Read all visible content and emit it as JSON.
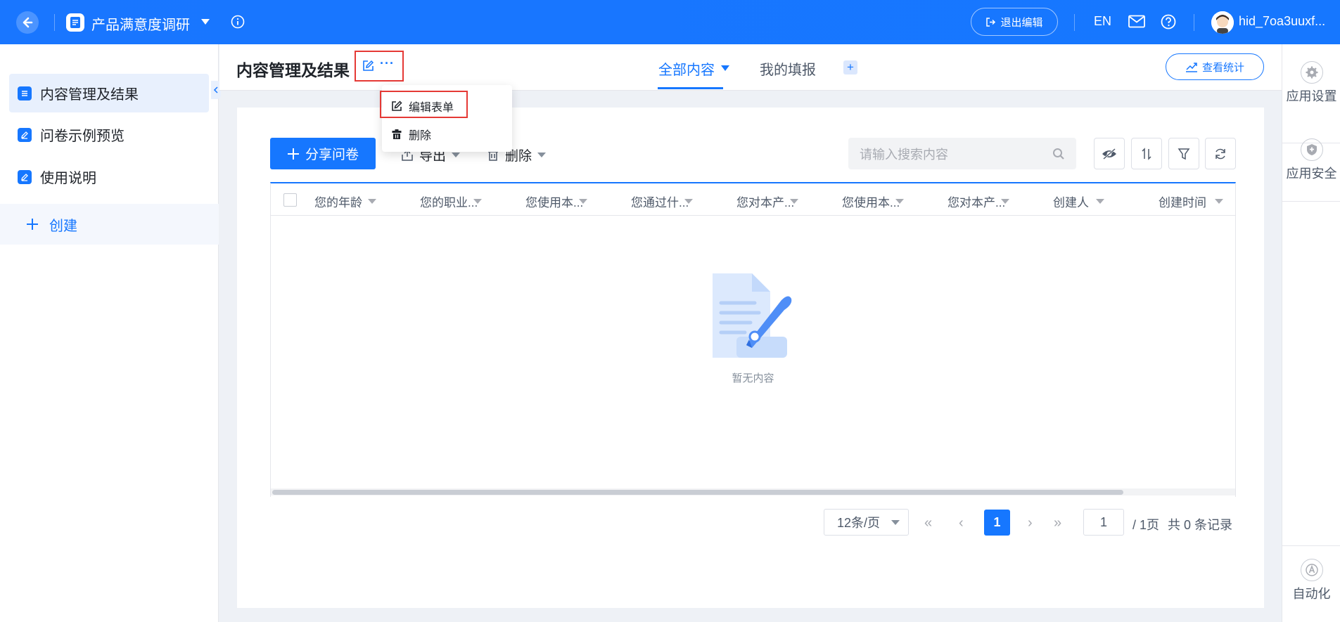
{
  "topbar": {
    "app_title": "产品满意度调研",
    "exit_edit_label": "退出编辑",
    "lang_label": "EN",
    "username": "hid_7oa3uuxf..."
  },
  "sidebar": {
    "items": [
      {
        "label": "内容管理及结果",
        "active": true
      },
      {
        "label": "问卷示例预览",
        "active": false
      },
      {
        "label": "使用说明",
        "active": false
      }
    ],
    "create_label": "创建"
  },
  "header": {
    "page_title": "内容管理及结果",
    "tabs": [
      {
        "label": "全部内容",
        "active": true
      },
      {
        "label": "我的填报",
        "active": false
      }
    ],
    "stats_label": "查看统计"
  },
  "toolbar": {
    "share_label": "分享问卷",
    "export_label": "导出",
    "delete_label": "删除",
    "search_placeholder": "请输入搜索内容"
  },
  "popup_menu": {
    "items": [
      "编辑表单",
      "删除"
    ]
  },
  "table": {
    "columns": [
      "您的年龄",
      "您的职业...",
      "您使用本...",
      "您通过什...",
      "您对本产...",
      "您使用本...",
      "您对本产...",
      "创建人",
      "创建时间"
    ],
    "rows": [],
    "empty_text": "暂无内容"
  },
  "pagination": {
    "page_size_label": "12条/页",
    "current_page": "1",
    "page_input": "1",
    "total_pages_text": "/ 1页",
    "total_records_text": "共 0 条记录"
  },
  "right_rail": {
    "items": [
      {
        "label": "应用设置",
        "icon": "gear-icon"
      },
      {
        "label": "应用安全",
        "icon": "shield-icon"
      },
      {
        "label": "自动化",
        "icon": "automation-icon"
      }
    ]
  },
  "colors": {
    "primary": "#1677ff",
    "highlight_border": "#e53935"
  }
}
